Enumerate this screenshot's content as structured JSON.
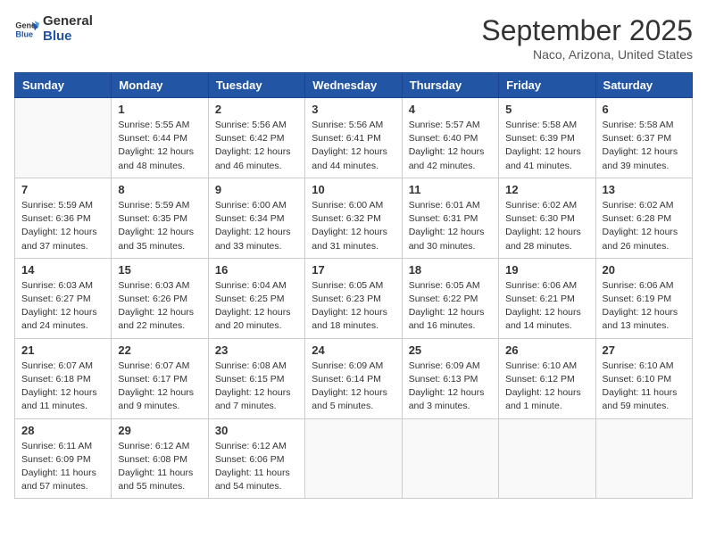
{
  "header": {
    "logo_general": "General",
    "logo_blue": "Blue",
    "month": "September 2025",
    "location": "Naco, Arizona, United States"
  },
  "days_of_week": [
    "Sunday",
    "Monday",
    "Tuesday",
    "Wednesday",
    "Thursday",
    "Friday",
    "Saturday"
  ],
  "weeks": [
    [
      {
        "day": "",
        "info": ""
      },
      {
        "day": "1",
        "info": "Sunrise: 5:55 AM\nSunset: 6:44 PM\nDaylight: 12 hours\nand 48 minutes."
      },
      {
        "day": "2",
        "info": "Sunrise: 5:56 AM\nSunset: 6:42 PM\nDaylight: 12 hours\nand 46 minutes."
      },
      {
        "day": "3",
        "info": "Sunrise: 5:56 AM\nSunset: 6:41 PM\nDaylight: 12 hours\nand 44 minutes."
      },
      {
        "day": "4",
        "info": "Sunrise: 5:57 AM\nSunset: 6:40 PM\nDaylight: 12 hours\nand 42 minutes."
      },
      {
        "day": "5",
        "info": "Sunrise: 5:58 AM\nSunset: 6:39 PM\nDaylight: 12 hours\nand 41 minutes."
      },
      {
        "day": "6",
        "info": "Sunrise: 5:58 AM\nSunset: 6:37 PM\nDaylight: 12 hours\nand 39 minutes."
      }
    ],
    [
      {
        "day": "7",
        "info": "Sunrise: 5:59 AM\nSunset: 6:36 PM\nDaylight: 12 hours\nand 37 minutes."
      },
      {
        "day": "8",
        "info": "Sunrise: 5:59 AM\nSunset: 6:35 PM\nDaylight: 12 hours\nand 35 minutes."
      },
      {
        "day": "9",
        "info": "Sunrise: 6:00 AM\nSunset: 6:34 PM\nDaylight: 12 hours\nand 33 minutes."
      },
      {
        "day": "10",
        "info": "Sunrise: 6:00 AM\nSunset: 6:32 PM\nDaylight: 12 hours\nand 31 minutes."
      },
      {
        "day": "11",
        "info": "Sunrise: 6:01 AM\nSunset: 6:31 PM\nDaylight: 12 hours\nand 30 minutes."
      },
      {
        "day": "12",
        "info": "Sunrise: 6:02 AM\nSunset: 6:30 PM\nDaylight: 12 hours\nand 28 minutes."
      },
      {
        "day": "13",
        "info": "Sunrise: 6:02 AM\nSunset: 6:28 PM\nDaylight: 12 hours\nand 26 minutes."
      }
    ],
    [
      {
        "day": "14",
        "info": "Sunrise: 6:03 AM\nSunset: 6:27 PM\nDaylight: 12 hours\nand 24 minutes."
      },
      {
        "day": "15",
        "info": "Sunrise: 6:03 AM\nSunset: 6:26 PM\nDaylight: 12 hours\nand 22 minutes."
      },
      {
        "day": "16",
        "info": "Sunrise: 6:04 AM\nSunset: 6:25 PM\nDaylight: 12 hours\nand 20 minutes."
      },
      {
        "day": "17",
        "info": "Sunrise: 6:05 AM\nSunset: 6:23 PM\nDaylight: 12 hours\nand 18 minutes."
      },
      {
        "day": "18",
        "info": "Sunrise: 6:05 AM\nSunset: 6:22 PM\nDaylight: 12 hours\nand 16 minutes."
      },
      {
        "day": "19",
        "info": "Sunrise: 6:06 AM\nSunset: 6:21 PM\nDaylight: 12 hours\nand 14 minutes."
      },
      {
        "day": "20",
        "info": "Sunrise: 6:06 AM\nSunset: 6:19 PM\nDaylight: 12 hours\nand 13 minutes."
      }
    ],
    [
      {
        "day": "21",
        "info": "Sunrise: 6:07 AM\nSunset: 6:18 PM\nDaylight: 12 hours\nand 11 minutes."
      },
      {
        "day": "22",
        "info": "Sunrise: 6:07 AM\nSunset: 6:17 PM\nDaylight: 12 hours\nand 9 minutes."
      },
      {
        "day": "23",
        "info": "Sunrise: 6:08 AM\nSunset: 6:15 PM\nDaylight: 12 hours\nand 7 minutes."
      },
      {
        "day": "24",
        "info": "Sunrise: 6:09 AM\nSunset: 6:14 PM\nDaylight: 12 hours\nand 5 minutes."
      },
      {
        "day": "25",
        "info": "Sunrise: 6:09 AM\nSunset: 6:13 PM\nDaylight: 12 hours\nand 3 minutes."
      },
      {
        "day": "26",
        "info": "Sunrise: 6:10 AM\nSunset: 6:12 PM\nDaylight: 12 hours\nand 1 minute."
      },
      {
        "day": "27",
        "info": "Sunrise: 6:10 AM\nSunset: 6:10 PM\nDaylight: 11 hours\nand 59 minutes."
      }
    ],
    [
      {
        "day": "28",
        "info": "Sunrise: 6:11 AM\nSunset: 6:09 PM\nDaylight: 11 hours\nand 57 minutes."
      },
      {
        "day": "29",
        "info": "Sunrise: 6:12 AM\nSunset: 6:08 PM\nDaylight: 11 hours\nand 55 minutes."
      },
      {
        "day": "30",
        "info": "Sunrise: 6:12 AM\nSunset: 6:06 PM\nDaylight: 11 hours\nand 54 minutes."
      },
      {
        "day": "",
        "info": ""
      },
      {
        "day": "",
        "info": ""
      },
      {
        "day": "",
        "info": ""
      },
      {
        "day": "",
        "info": ""
      }
    ]
  ]
}
